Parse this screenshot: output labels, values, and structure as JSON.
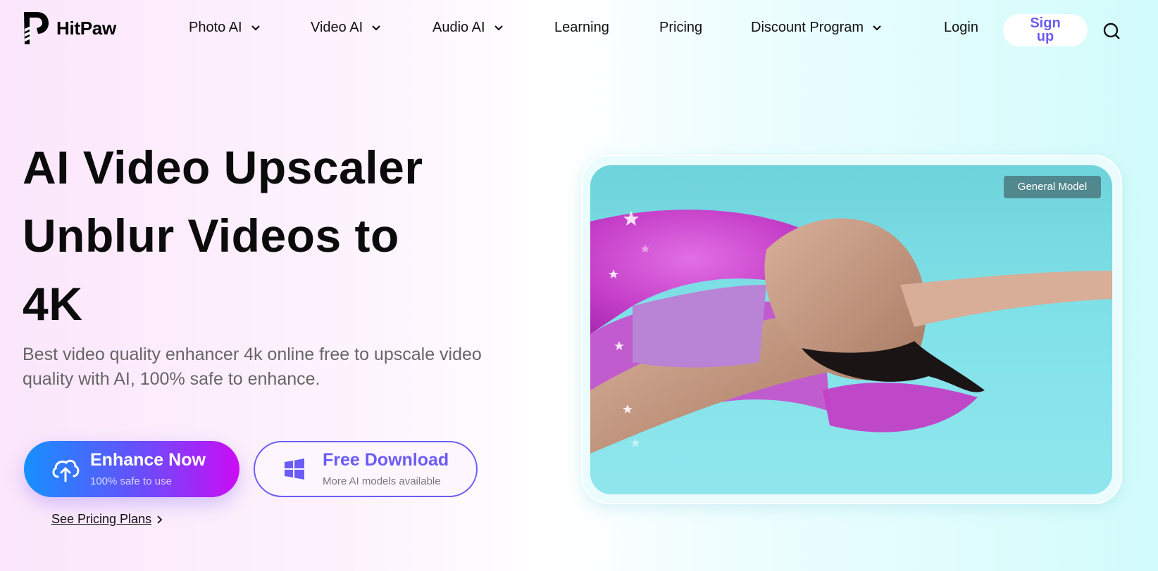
{
  "brand": {
    "name": "HitPaw",
    "accent": "#6a5cf5"
  },
  "nav": {
    "items": [
      {
        "label": "Photo AI",
        "dropdown": true
      },
      {
        "label": "Video AI",
        "dropdown": true
      },
      {
        "label": "Audio AI",
        "dropdown": true
      },
      {
        "label": "Learning",
        "dropdown": false
      },
      {
        "label": "Pricing",
        "dropdown": false
      },
      {
        "label": "Discount Program",
        "dropdown": true
      },
      {
        "label": "Login",
        "dropdown": false
      }
    ],
    "signup_label": "Sign up",
    "search_icon": "search-icon"
  },
  "hero": {
    "headline_lines": [
      "AI Video Upscaler",
      "Unblur Videos to",
      "4K"
    ],
    "subtext": "Best video quality enhancer 4k online free to upscale video quality with AI, 100% safe to enhance.",
    "primary_button": {
      "title": "Enhance Now",
      "subtitle": "100% safe to use",
      "icon": "cloud-upload-icon"
    },
    "secondary_button": {
      "title": "Free Download",
      "subtitle": "More AI models available",
      "icon": "windows-icon"
    },
    "pricing_link": "See Pricing Plans",
    "media": {
      "badge": "General Model",
      "description": "Woman floating on pink inflatable ring in a swimming pool"
    }
  }
}
